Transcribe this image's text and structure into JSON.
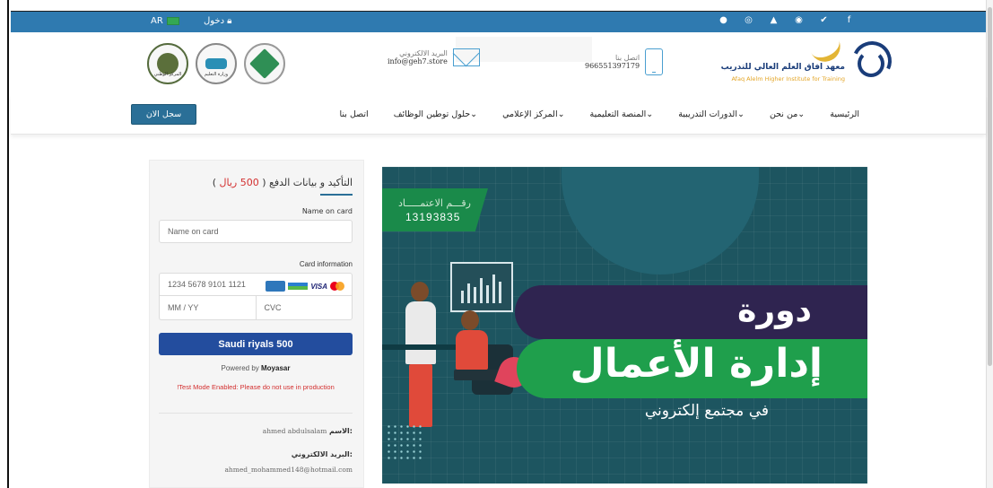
{
  "topbar": {
    "lang": "AR",
    "login": "دخول",
    "social_icons": [
      "instagram-icon",
      "photo-icon",
      "youtube-icon",
      "whatsapp-icon",
      "twitter-icon",
      "facebook-icon"
    ],
    "social_glyphs": [
      "●",
      "◎",
      "▲",
      "◉",
      "✔",
      "f"
    ],
    "color": "#2f7ab0"
  },
  "header": {
    "email_label": "البريد الالكتروني",
    "email_value": "info@geh7.store",
    "phone_label": "اتصل بنا",
    "phone_value": "966551397179",
    "brand_ar": "معهد افاق العلم العالي للتدريب",
    "brand_en": "Afaq Alelm Higher Institute for Training",
    "seal1_text": "المركز الوطني",
    "seal2_text": "وزارة التعليم"
  },
  "nav": {
    "items": [
      "الرئيسية",
      "من نحن",
      "الدورات التدريبية",
      "المنصة التعليمية",
      "المركز الإعلامي",
      "حلول توطين الوظائف",
      "اتصل بنا"
    ],
    "cta": "سجل الان"
  },
  "payment": {
    "title_prefix": "التأكيد و بيانات الدفع (",
    "title_price": "500 ريال",
    "title_suffix": ")",
    "name_label": "Name on card",
    "name_placeholder": "Name on card",
    "card_label": "Card information",
    "card_placeholder": "1234 5678 9101 1121",
    "expiry_placeholder": "MM / YY",
    "cvc_placeholder": "CVC",
    "card_brands": [
      "amex",
      "mada",
      "VISA",
      "mastercard"
    ],
    "visa_text": "VISA",
    "pay_button": "Saudi riyals 500",
    "powered_prefix": "Powered by",
    "powered_brand": "Moyasar",
    "test_mode": "!Test Mode Enabled: Please do not use in production",
    "name_key": "الاسم:",
    "name_value": "ahmed abdulsalam",
    "email_key": "البريد الالكتروني:",
    "email_value": "ahmed_mohammed148@hotmail.com",
    "accent": "#d32f2f",
    "button_color": "#234d9e"
  },
  "banner": {
    "accreditation_label": "رقـــم الاعتمـــــاد",
    "accreditation_number": "13193835",
    "line1": "دورة",
    "line2": "إدارة الأعمال",
    "line3": "في مجتمع إلكتروني"
  }
}
